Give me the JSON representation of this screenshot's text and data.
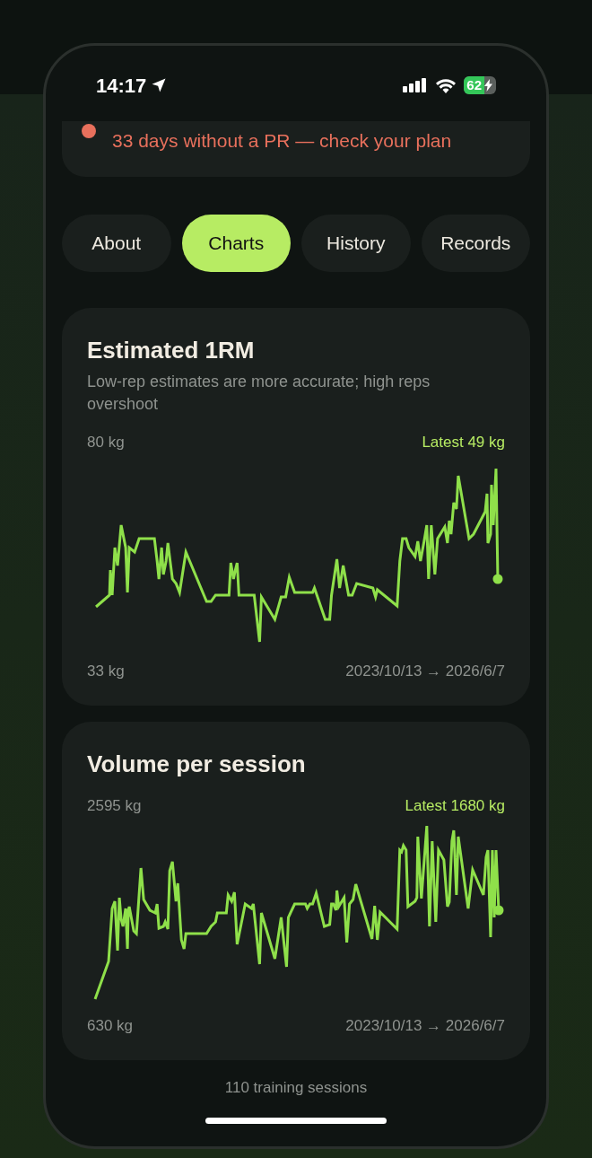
{
  "status_bar": {
    "time": "14:17",
    "battery": "62"
  },
  "alert": {
    "text": "33 days without a PR — check your plan"
  },
  "tabs": [
    {
      "label": "About",
      "selected": false
    },
    {
      "label": "Charts",
      "selected": true
    },
    {
      "label": "History",
      "selected": false
    },
    {
      "label": "Records",
      "selected": false
    }
  ],
  "cards": [
    {
      "title": "Estimated 1RM",
      "subtitle": "Low-rep estimates are more accurate; high reps overshoot",
      "max_label": "80 kg",
      "latest": "Latest 49 kg",
      "min_label": "33 kg",
      "range": "2023/10/13 → 2026/6/7"
    },
    {
      "title": "Volume per session",
      "max_label": "2595 kg",
      "latest": "Latest 1680 kg",
      "min_label": "630 kg",
      "range": "2023/10/13 → 2026/6/7"
    }
  ],
  "footer": "110 training sessions"
}
